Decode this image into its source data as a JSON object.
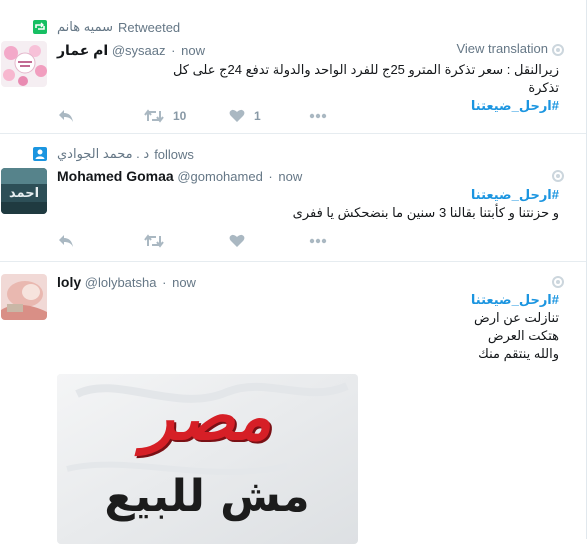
{
  "tweets": [
    {
      "context_name": "سميه هانم",
      "context_label": "Retweeted",
      "context_icon": "retweet-icon",
      "fullname": "ام عمار",
      "username": "@sysaaz",
      "time": "now",
      "view_translation": "View translation",
      "text_line1": "زيرالنقل : سعر تذكرة المترو 25ج للفرد الواحد والدولة تدفع 24ج على كل تذكرة",
      "hashtag": "#ارحل_ضيعتنا",
      "retweet_count": "10",
      "like_count": "1"
    },
    {
      "context_name": "د . محمد الجوادي",
      "context_label": "follows",
      "context_icon": "person-icon",
      "fullname": "Mohamed Gomaa",
      "username": "@gomohamed",
      "time": "now",
      "hashtag": "#ارحل_ضيعتنا",
      "text_line1": "و حزنتنا و كأبتنا بقالنا 3 سنين ما بنضحكش يا ففرى"
    },
    {
      "fullname": "loly",
      "username": "@lolybatsha",
      "time": "now",
      "hashtag": "#ارحل_ضيعتنا",
      "text_line1": "تنازلت عن ارض",
      "text_line2": "هتكت العرض",
      "text_line3": "والله ينتقم منك",
      "image_line1": "مصر",
      "image_line2": "مش للبيع"
    }
  ],
  "colors": {
    "link": "#1b95e0",
    "muted": "#657786",
    "retweet_green": "#17bf63",
    "action_gray": "#aab8c2",
    "image_red": "#d61f26"
  }
}
